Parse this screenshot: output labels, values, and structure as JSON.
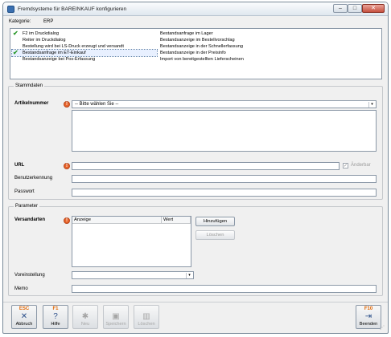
{
  "window": {
    "title": "Fremdsysteme für BAREINKAUF konfigurieren"
  },
  "header": {
    "kategorie_label": "Kategorie:",
    "kategorie_value": "ERP"
  },
  "functions": {
    "left": [
      {
        "label": "F2 im Druckdialog",
        "checked": true
      },
      {
        "label": "Reiter im Druckdialog",
        "checked": false
      },
      {
        "label": "Bestellung wird bei LS-Druck erzeugt und versandt",
        "checked": false
      },
      {
        "label": "Bestandsanfrage im ET-Einkauf",
        "checked": true,
        "selected": true
      },
      {
        "label": "Bestandsanzeige bei Pos-Erfassung",
        "checked": false
      }
    ],
    "right": [
      {
        "label": "Bestandsanfrage im Lager"
      },
      {
        "label": "Bestandsanzeige im Bestellvorschlag"
      },
      {
        "label": "Bestandsanzeige in der Schnellerfassung"
      },
      {
        "label": "Bestandsanzeige in der Preisinfo"
      },
      {
        "label": "Import von bereitgestellten Lieferscheinen"
      }
    ]
  },
  "stammdaten": {
    "title": "Stammdaten",
    "artikelnummer_label": "Artikelnummer",
    "artikelnummer_value": "-- Bitte wählen Sie --",
    "url_label": "URL",
    "url_value": "",
    "aenderbar_label": "Änderbar",
    "benutzer_label": "Benutzerkennung",
    "benutzer_value": "",
    "passwort_label": "Passwort",
    "passwort_value": ""
  },
  "parameter": {
    "title": "Parameter",
    "versandarten_label": "Versandarten",
    "col_anzeige": "Anzeige",
    "col_wert": "Wert",
    "add_button": "Hinzufügen",
    "delete_button": "Löschen",
    "voreinstellung_label": "Voreinstellung",
    "voreinstellung_value": "",
    "memo_label": "Memo",
    "memo_value": ""
  },
  "footer": {
    "esc": {
      "key": "ESC",
      "label": "Abbruch"
    },
    "f1": {
      "key": "F1",
      "label": "Hilfe"
    },
    "neu": {
      "label": "Neu"
    },
    "speichern": {
      "label": "Speichern"
    },
    "loeschen": {
      "label": "Löschen"
    },
    "f10": {
      "key": "F10",
      "label": "Beenden"
    }
  },
  "colors": {
    "accent": "#e06400",
    "check": "#2e9a2e",
    "warning": "#e8642a"
  }
}
